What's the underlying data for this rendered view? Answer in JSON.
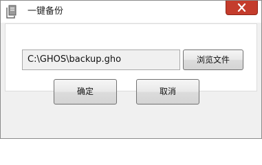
{
  "window": {
    "title": "一键备份",
    "icon": "document-icon"
  },
  "titlebar": {
    "close_icon": "close-icon",
    "close_color": "#c43c2c"
  },
  "form": {
    "path_value": "C:\\GHOS\\backup.gho",
    "browse_label": "浏览文件"
  },
  "footer": {
    "ok_label": "确定",
    "cancel_label": "取消"
  }
}
